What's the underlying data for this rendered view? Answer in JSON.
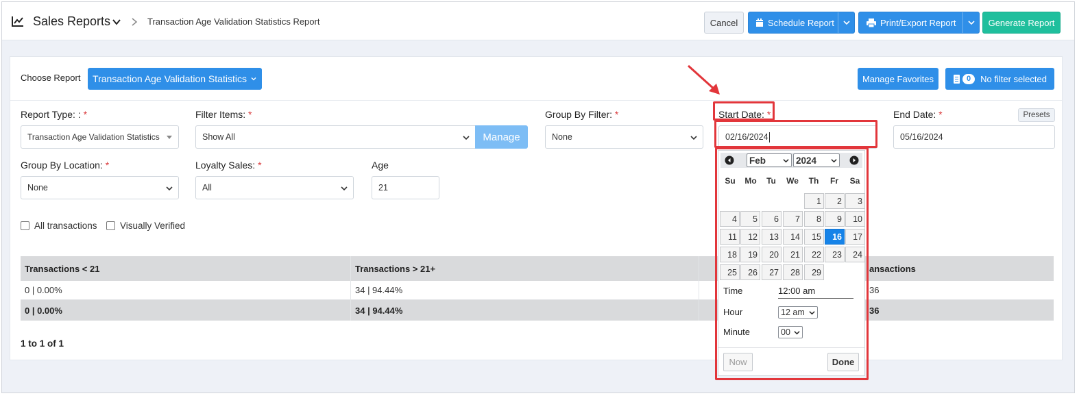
{
  "header": {
    "app_title": "Sales Reports",
    "breadcrumb": "Transaction Age Validation Statistics Report",
    "cancel_label": "Cancel",
    "schedule_label": "Schedule Report",
    "print_label": "Print/Export Report",
    "generate_label": "Generate Report"
  },
  "toolbar": {
    "choose_label": "Choose Report",
    "report_button": "Transaction Age Validation Statistics",
    "manage_favorites": "Manage Favorites",
    "filter_count": "0",
    "filter_label": "No filter selected"
  },
  "form": {
    "report_type_label": "Report Type: :",
    "report_type_value": "Transaction Age Validation Statistics",
    "filter_items_label": "Filter Items:",
    "filter_items_value": "Show All",
    "manage_label": "Manage",
    "group_by_filter_label": "Group By Filter:",
    "group_by_filter_value": "None",
    "start_date_label": "Start Date:",
    "start_date_value": "02/16/2024",
    "end_date_label": "End Date:",
    "end_date_value": "05/16/2024",
    "presets_label": "Presets",
    "group_by_location_label": "Group By Location:",
    "group_by_location_value": "None",
    "loyalty_sales_label": "Loyalty Sales:",
    "loyalty_sales_value": "All",
    "age_label": "Age",
    "age_value": "21",
    "required_mark": "*",
    "all_transactions_label": "All transactions",
    "visually_verified_label": "Visually Verified"
  },
  "table": {
    "headers": [
      "Transactions < 21",
      "Transactions > 21+",
      "",
      "ansactions"
    ],
    "rows": [
      [
        "0 | 0.00%",
        "34 | 94.44%",
        "",
        "36"
      ],
      [
        "0 | 0.00%",
        "34 | 94.44%",
        "",
        "36"
      ]
    ],
    "pager": "1 to 1 of 1"
  },
  "datepicker": {
    "month": "Feb",
    "year": "2024",
    "weekdays": [
      "Su",
      "Mo",
      "Tu",
      "We",
      "Th",
      "Fr",
      "Sa"
    ],
    "days": [
      "1",
      "2",
      "3",
      "4",
      "5",
      "6",
      "7",
      "8",
      "9",
      "10",
      "11",
      "12",
      "13",
      "14",
      "15",
      "16",
      "17",
      "18",
      "19",
      "20",
      "21",
      "22",
      "23",
      "24",
      "25",
      "26",
      "27",
      "28",
      "29"
    ],
    "selected_day": "16",
    "time_label": "Time",
    "time_value": "12:00 am",
    "hour_label": "Hour",
    "hour_value": "12 am",
    "minute_label": "Minute",
    "minute_value": "00",
    "now_label": "Now",
    "done_label": "Done"
  },
  "colors": {
    "accent": "#2f8fe8",
    "generate": "#1fbf9d",
    "highlight": "#e2363b",
    "selected_day": "#1683e8"
  }
}
